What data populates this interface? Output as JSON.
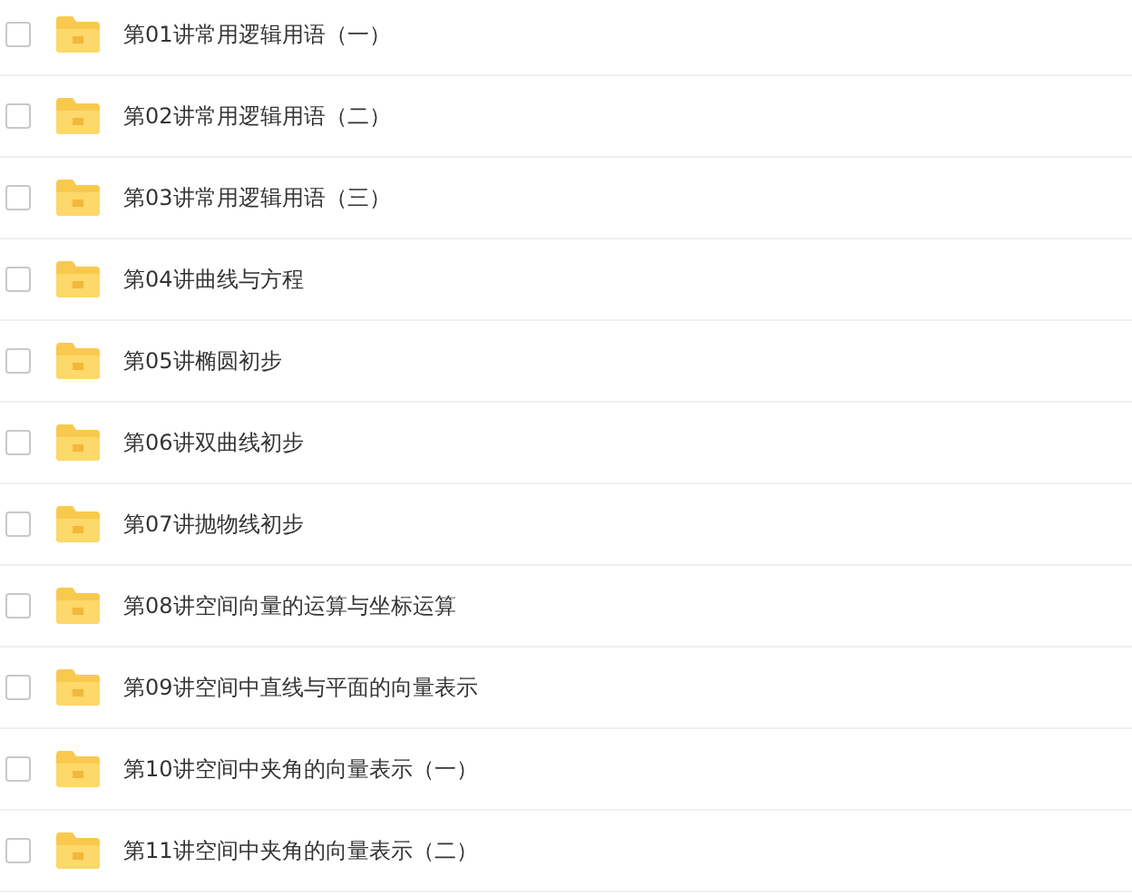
{
  "files": [
    {
      "name": "第01讲常用逻辑用语（一）",
      "checked": false
    },
    {
      "name": "第02讲常用逻辑用语（二）",
      "checked": false
    },
    {
      "name": "第03讲常用逻辑用语（三）",
      "checked": false
    },
    {
      "name": "第04讲曲线与方程",
      "checked": false
    },
    {
      "name": "第05讲椭圆初步",
      "checked": false
    },
    {
      "name": "第06讲双曲线初步",
      "checked": false
    },
    {
      "name": "第07讲抛物线初步",
      "checked": false
    },
    {
      "name": "第08讲空间向量的运算与坐标运算",
      "checked": false
    },
    {
      "name": "第09讲空间中直线与平面的向量表示",
      "checked": false
    },
    {
      "name": "第10讲空间中夹角的向量表示（一）",
      "checked": false
    },
    {
      "name": "第11讲空间中夹角的向量表示（二）",
      "checked": false
    }
  ]
}
